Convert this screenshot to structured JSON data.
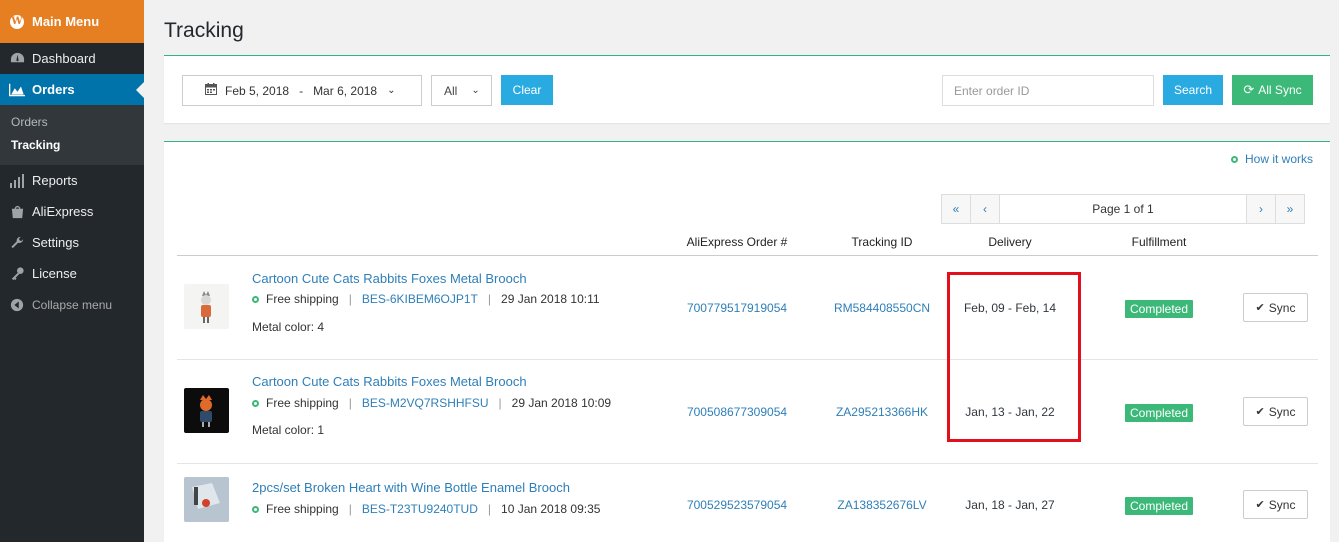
{
  "sidebar": {
    "main_menu": "Main Menu",
    "items": [
      {
        "label": "Dashboard",
        "icon": "dashboard-icon"
      },
      {
        "label": "Orders",
        "icon": "chart-area-icon"
      },
      {
        "label": "Reports",
        "icon": "bar-chart-icon"
      },
      {
        "label": "AliExpress",
        "icon": "shopping-bag-icon"
      },
      {
        "label": "Settings",
        "icon": "wrench-icon"
      },
      {
        "label": "License",
        "icon": "key-icon"
      },
      {
        "label": "Collapse menu",
        "icon": "collapse-icon"
      }
    ],
    "submenu": [
      "Orders",
      "Tracking"
    ]
  },
  "page": {
    "title": "Tracking"
  },
  "filters": {
    "date_from": "Feb 5, 2018",
    "date_sep": "-",
    "date_to": "Mar 6, 2018",
    "status_value": "All",
    "clear_label": "Clear",
    "order_placeholder": "Enter order ID",
    "search_label": "Search",
    "sync_all_label": "All Sync"
  },
  "list": {
    "how_it_works": "How it works",
    "pager": {
      "first": "«",
      "prev": "‹",
      "label": "Page 1 of 1",
      "next": "›",
      "last": "»"
    },
    "columns": [
      "AliExpress Order #",
      "Tracking ID",
      "Delivery",
      "Fulfillment"
    ],
    "rows": [
      {
        "title": "Cartoon Cute Cats Rabbits Foxes Metal Brooch",
        "shipping": "Free shipping",
        "sku": "BES-6KIBEM6OJP1T",
        "date": "29 Jan 2018 10:11",
        "variant": "Metal color: 4",
        "order_no": "700779517919054",
        "tracking_id": "RM584408550CN",
        "delivery": "Feb, 09 - Feb, 14",
        "status": "Completed",
        "sync": "Sync"
      },
      {
        "title": "Cartoon Cute Cats Rabbits Foxes Metal Brooch",
        "shipping": "Free shipping",
        "sku": "BES-M2VQ7RSHHFSU",
        "date": "29 Jan 2018 10:09",
        "variant": "Metal color: 1",
        "order_no": "700508677309054",
        "tracking_id": "ZA295213366HK",
        "delivery": "Jan, 13 - Jan, 22",
        "status": "Completed",
        "sync": "Sync"
      },
      {
        "title": "2pcs/set Broken Heart with Wine Bottle Enamel Brooch",
        "shipping": "Free shipping",
        "sku": "BES-T23TU9240TUD",
        "date": "10 Jan 2018 09:35",
        "variant": "",
        "order_no": "700529523579054",
        "tracking_id": "ZA138352676LV",
        "delivery": "Jan, 18 - Jan, 27",
        "status": "Completed",
        "sync": "Sync"
      }
    ]
  },
  "colors": {
    "sidebar_bg": "#23282d",
    "main_menu": "#e67e22",
    "active": "#0073aa",
    "link": "#2e7fb8",
    "button_blue": "#29abe2",
    "success": "#3cb878",
    "highlight": "#e3101c"
  }
}
